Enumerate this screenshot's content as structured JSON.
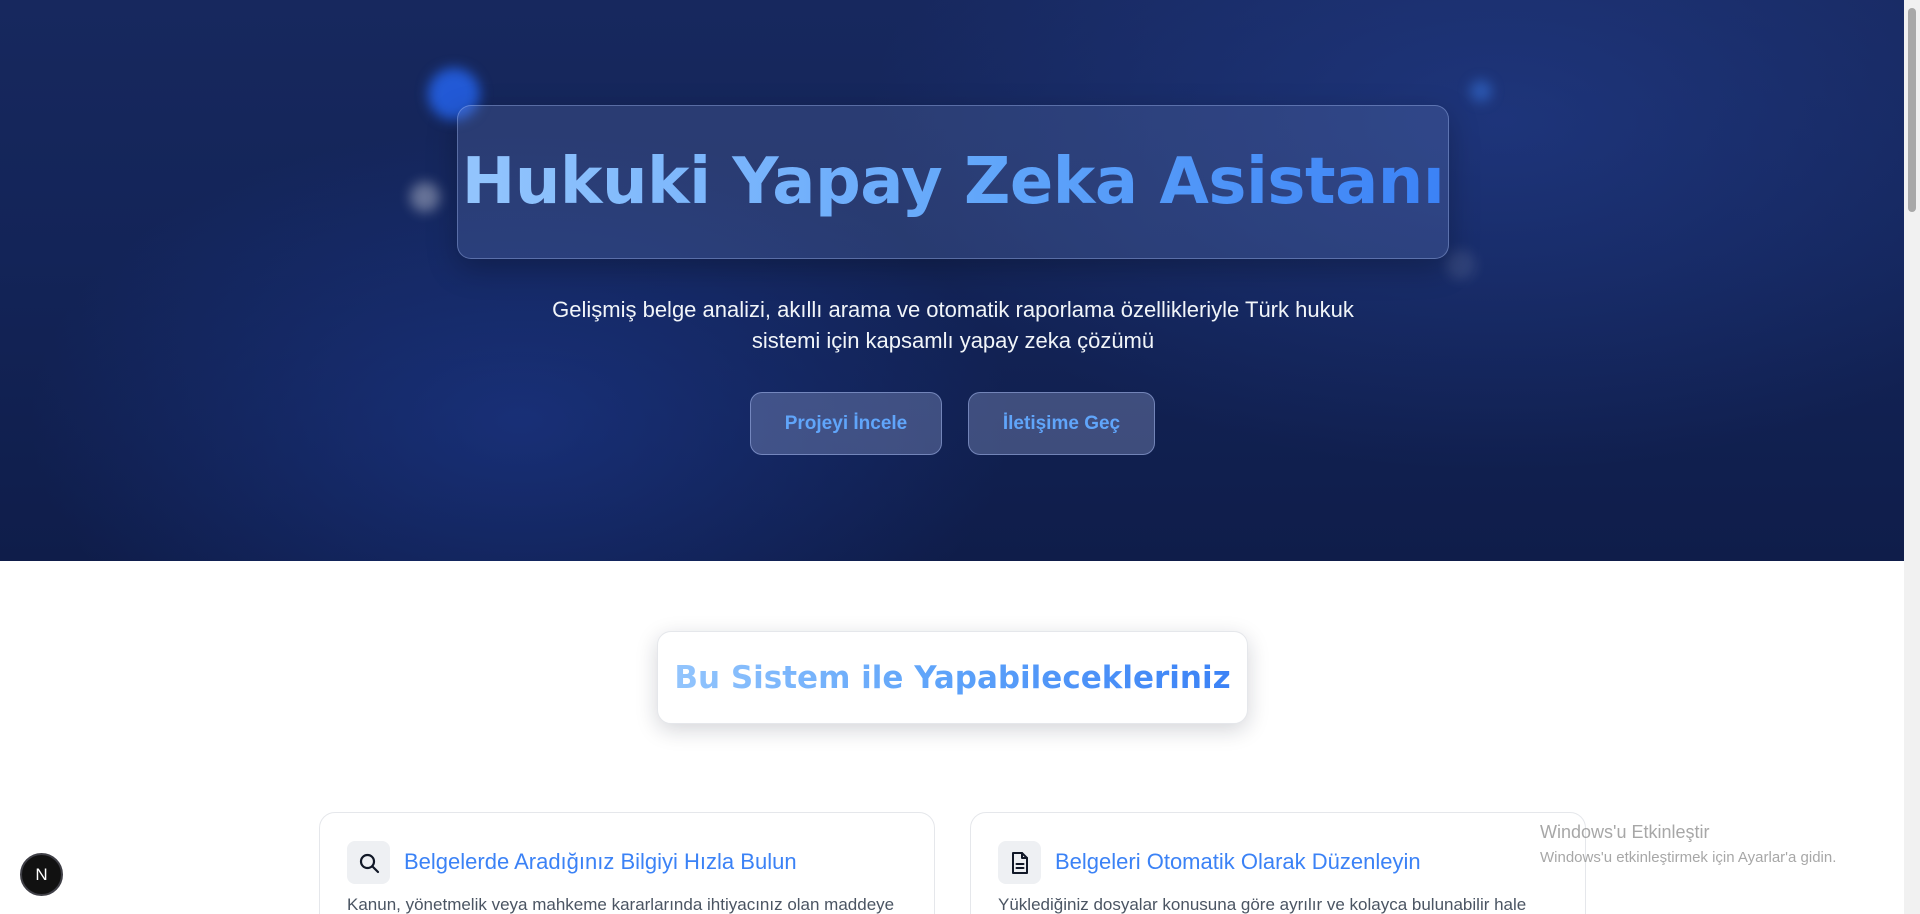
{
  "hero": {
    "title": "Hukuki Yapay Zeka Asistanı",
    "subtitle": "Gelişmiş belge analizi, akıllı arama ve otomatik raporlama özellikleriyle Türk hukuk sistemi için kapsamlı yapay zeka çözümü",
    "primary_button": "Projeyi İncele",
    "secondary_button": "İletişime Geç"
  },
  "features": {
    "section_title": "Bu Sistem ile Yapabilecekleriniz",
    "cards": [
      {
        "icon": "search-icon",
        "title": "Belgelerde Aradığınız Bilgiyi Hızla Bulun",
        "description": "Kanun, yönetmelik veya mahkeme kararlarında ihtiyacınız olan maddeye"
      },
      {
        "icon": "document-icon",
        "title": "Belgeleri Otomatik Olarak Düzenleyin",
        "description": "Yüklediğiniz dosyalar konusuna göre ayrılır ve kolayca bulunabilir hale"
      }
    ]
  },
  "watermark": {
    "title": "Windows'u Etkinleştir",
    "subtitle": "Windows'u etkinleştirmek için Ayarlar'a gidin."
  },
  "floating_button": {
    "label": "N"
  },
  "colors": {
    "hero_background": "#132458",
    "accent": "#3b82f6",
    "accent_light": "#93c5fd"
  }
}
